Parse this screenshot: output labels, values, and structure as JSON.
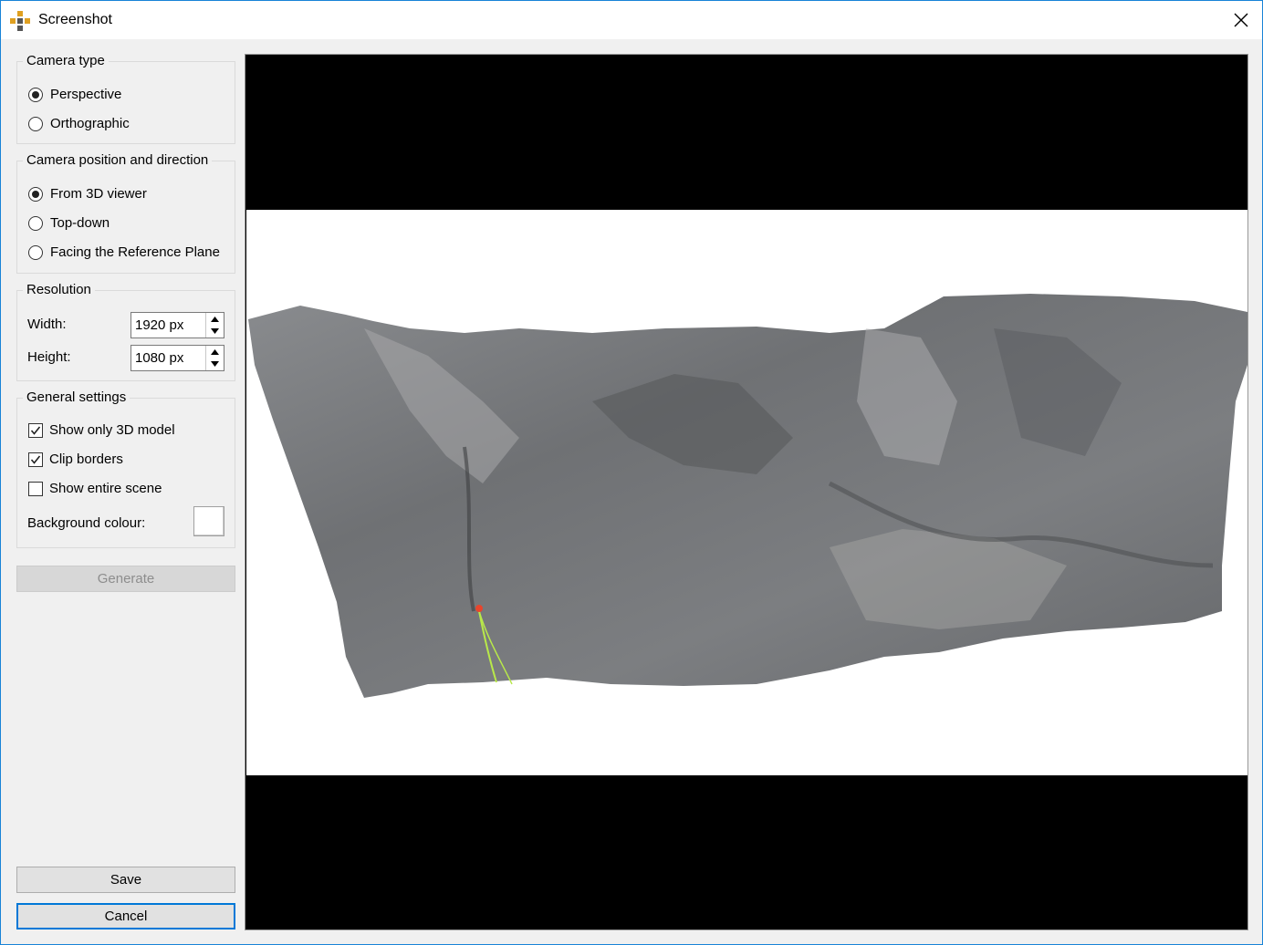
{
  "window": {
    "title": "Screenshot"
  },
  "camera_type": {
    "title": "Camera type",
    "options": [
      {
        "label": "Perspective",
        "checked": true
      },
      {
        "label": "Orthographic",
        "checked": false
      }
    ]
  },
  "camera_position": {
    "title": "Camera position and direction",
    "options": [
      {
        "label": "From 3D viewer",
        "checked": true
      },
      {
        "label": "Top-down",
        "checked": false
      },
      {
        "label": "Facing the Reference Plane",
        "checked": false
      }
    ]
  },
  "resolution": {
    "title": "Resolution",
    "width_label": "Width:",
    "width_value": "1920 px",
    "height_label": "Height:",
    "height_value": "1080 px"
  },
  "general_settings": {
    "title": "General settings",
    "show_only_3d_model": {
      "label": "Show only 3D model",
      "checked": true
    },
    "clip_borders": {
      "label": "Clip borders",
      "checked": true
    },
    "show_entire_scene": {
      "label": "Show entire scene",
      "checked": false
    },
    "background_colour_label": "Background colour:",
    "background_colour": "#ffffff"
  },
  "buttons": {
    "generate": "Generate",
    "save": "Save",
    "cancel": "Cancel"
  },
  "colors": {
    "accent": "#0078d7",
    "window_border": "#1883d7",
    "rock": "#7d7f82",
    "marker": "#e8452c",
    "trace": "#b8e84a"
  },
  "icons": [
    "app-logo-icon",
    "close-icon",
    "checkmark-icon",
    "spin-up-icon",
    "spin-down-icon"
  ]
}
